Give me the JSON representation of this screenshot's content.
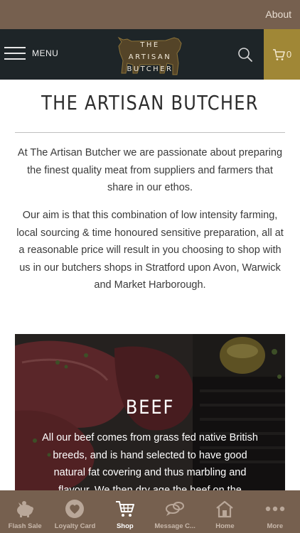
{
  "top_strip": {
    "about_label": "About"
  },
  "header": {
    "menu_label": "MENU",
    "logo_lines": [
      "THE",
      "ARTISAN",
      "BUTCHER"
    ],
    "cart_count": "0",
    "cart_color": "#a08736"
  },
  "main": {
    "title": "THE ARTISAN BUTCHER",
    "paragraphs": [
      "At The Artisan Butcher we are passionate about preparing the finest quality meat from suppliers and farmers that share in our ethos.",
      "Our aim is that this combination of low intensity farming, local sourcing & time honoured sensitive preparation, all at a reasonable price will result in you choosing to shop with us in our butchers shops in Stratford upon Avon, Warwick and Market Harborough."
    ],
    "beef_card": {
      "title": "BEEF",
      "text": "All our beef comes from grass fed native British breeds, and is hand selected to have good natural fat covering and thus marbling and flavour. We then dry age the beef on the"
    }
  },
  "tabbar": {
    "tabs": [
      {
        "label": "Flash Sale",
        "icon": "piggy-bank-icon"
      },
      {
        "label": "Loyalty Card",
        "icon": "heart-badge-icon"
      },
      {
        "label": "Shop",
        "icon": "shopping-cart-icon"
      },
      {
        "label": "Message C...",
        "icon": "chat-bubbles-icon"
      },
      {
        "label": "Home",
        "icon": "home-icon"
      },
      {
        "label": "More",
        "icon": "more-dots-icon"
      }
    ],
    "active": "Shop",
    "background": "#76604f"
  }
}
